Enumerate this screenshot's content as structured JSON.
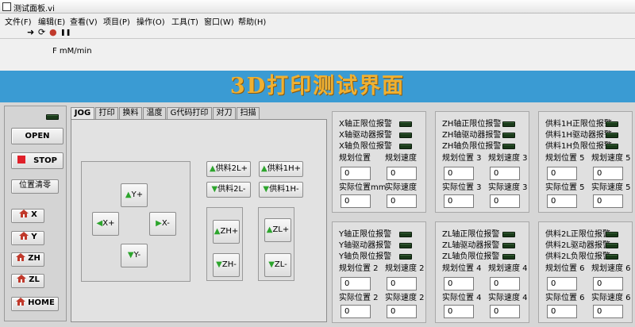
{
  "window": {
    "title": "测试面板.vi"
  },
  "menu": [
    "文件(F)",
    "编辑(E)",
    "查看(V)",
    "项目(P)",
    "操作(O)",
    "工具(T)",
    "窗口(W)",
    "帮助(H)"
  ],
  "toolbar": {
    "run": "➜",
    "run_continuous": "⟳",
    "abort": "●",
    "pause": "❚❚"
  },
  "feed_label": "F mM/min",
  "banner_title": "3D打印测试界面",
  "left_buttons": {
    "open": "OPEN",
    "stop": "STOP",
    "pos_clear": "位置清零",
    "x": "X",
    "y": "Y",
    "zh": "ZH",
    "zl": "ZL",
    "home": "HOME"
  },
  "tabs": [
    "JOG",
    "打印",
    "换料",
    "温度",
    "G代码打印",
    "对刀",
    "扫描"
  ],
  "jog": {
    "y_plus": "Y+",
    "x_plus": "X+",
    "x_minus": "X-",
    "y_minus": "Y-",
    "zh_plus": "ZH+",
    "zh_minus": "ZH-",
    "zl_plus": "ZL+",
    "zl_minus": "ZL-",
    "feed2l_plus": "供料2L+",
    "feed1h_plus": "供料1H+",
    "feed2l_minus": "供料2L-",
    "feed1h_minus": "供料1H-"
  },
  "axis_groups": [
    {
      "pos": "正限位报警",
      "drv": "驱动器报警",
      "neg": "负限位报警",
      "axis": "X",
      "plan_pos": "规划位置",
      "plan_speed": "规划速度",
      "act_pos": "实际位置mm",
      "act_speed": "实际速度",
      "v1": "0",
      "v2": "0",
      "v3": "0",
      "v4": "0"
    },
    {
      "axis": "ZH",
      "plan_pos": "规划位置 3",
      "plan_speed": "规划速度 3",
      "act_pos": "实际位置 3",
      "act_speed": "实际速度 3",
      "v1": "0",
      "v2": "0",
      "v3": "0",
      "v4": "0"
    },
    {
      "axis": "供料1H",
      "plan_pos": "规划位置 5",
      "plan_speed": "规划速度 5",
      "act_pos": "实际位置 5",
      "act_speed": "实际速度 5",
      "v1": "0",
      "v2": "0",
      "v3": "0",
      "v4": "0"
    },
    {
      "axis": "Y",
      "plan_pos": "规划位置 2",
      "plan_speed": "规划速度 2",
      "act_pos": "实际位置 2",
      "act_speed": "实际速度 2",
      "v1": "0",
      "v2": "0",
      "v3": "0",
      "v4": "0"
    },
    {
      "axis": "ZL",
      "plan_pos": "规划位置 4",
      "plan_speed": "规划速度 4",
      "act_pos": "实际位置 4",
      "act_speed": "实际速度 4",
      "v1": "0",
      "v2": "0",
      "v3": "0",
      "v4": "0"
    },
    {
      "axis": "供料2L",
      "plan_pos": "规划位置 6",
      "plan_speed": "规划速度 6",
      "act_pos": "实际位置 6",
      "act_speed": "实际速度 6",
      "v1": "0",
      "v2": "0",
      "v3": "0",
      "v4": "0"
    }
  ],
  "alarm_labels": [
    [
      "X轴正限位报警",
      "X轴驱动器报警",
      "X轴负限位报警"
    ],
    [
      "ZH轴正限位报警",
      "ZH轴驱动器报警",
      "ZH轴负限位报警"
    ],
    [
      "供料1H正限位报警",
      "供料1H驱动器报警",
      "供料1H负限位报警"
    ],
    [
      "Y轴正限位报警",
      "Y轴驱动器报警",
      "Y轴负限位报警"
    ],
    [
      "ZL轴正限位报警",
      "ZL轴驱动器报警",
      "ZL轴负限位报警"
    ],
    [
      "供料2L正限位报警",
      "供料2L驱动器报警",
      "供料2L负限位报警"
    ]
  ],
  "colors": {
    "banner_bg": "#3a9bd3",
    "banner_text": "#f0b030",
    "led_off": "#1a3a1a",
    "arrow_green": "#2da52d",
    "home_red": "#c0392b"
  }
}
